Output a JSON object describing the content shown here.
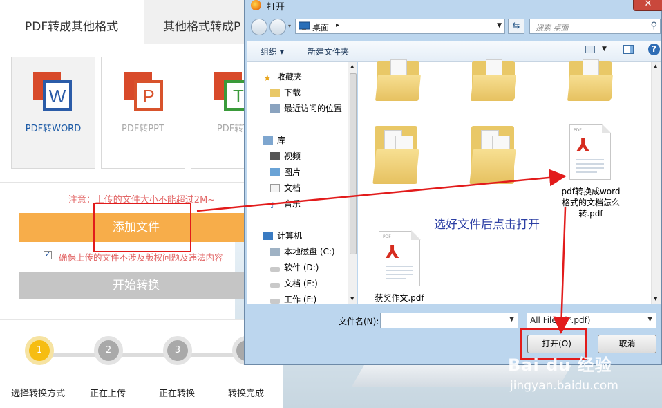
{
  "web": {
    "tabs": [
      "PDF转成其他格式",
      "其他格式转成P"
    ],
    "cards": [
      {
        "label": "PDF转WORD",
        "letter": "W",
        "icon": "word-icon",
        "color": "#2b5ca8"
      },
      {
        "label": "PDF转PPT",
        "letter": "P",
        "icon": "ppt-icon",
        "color": "#d8532c"
      },
      {
        "label": "PDF转T",
        "letter": "T",
        "icon": "txt-icon",
        "color": "#3a9a3a"
      }
    ],
    "notice": "注意：上传的文件大小不能超过2M~",
    "add_button": "添加文件",
    "checkbox_label": "确保上传的文件不涉及版权问题及违法内容",
    "start_button": "开始转换",
    "steps": [
      {
        "number": "1",
        "label": "选择转换方式"
      },
      {
        "number": "2",
        "label": "正在上传"
      },
      {
        "number": "3",
        "label": "正在转换"
      },
      {
        "number": "4",
        "label": "转换完成"
      }
    ]
  },
  "dialog": {
    "title": "打开",
    "close": "✕",
    "address": "桌面",
    "search_placeholder": "搜索 桌面",
    "toolbar": {
      "organize": "组织 ▾",
      "new_folder": "新建文件夹"
    },
    "nav": {
      "favorites": "收藏夹",
      "downloads": "下载",
      "recent": "最近访问的位置",
      "libraries": "库",
      "videos": "视频",
      "pictures": "图片",
      "documents": "文档",
      "music": "音乐",
      "computer": "计算机",
      "drive_c": "本地磁盘 (C:)",
      "drive_d": "软件 (D:)",
      "drive_e": "文档 (E:)",
      "drive_f": "工作 (F:)"
    },
    "files": {
      "pdf1": "pdf转换成word\n格式的文档怎么\n转.pdf",
      "pdf2": "获奖作文.pdf"
    },
    "filename_label": "文件名(N):",
    "filename_value": "",
    "filter": "All Files (*.pdf)",
    "open_button": "打开(O)",
    "cancel_button": "取消"
  },
  "annotation": {
    "hint": "选好文件后点击打开"
  },
  "watermark": {
    "brand": "Bai du 经验",
    "url": "jingyan.baidu.com"
  },
  "colors": {
    "accent_orange": "#f7ad4a",
    "step_active": "#f6bd12",
    "annotation_red": "#e21b1b",
    "hint_blue": "#2c3fa4"
  }
}
